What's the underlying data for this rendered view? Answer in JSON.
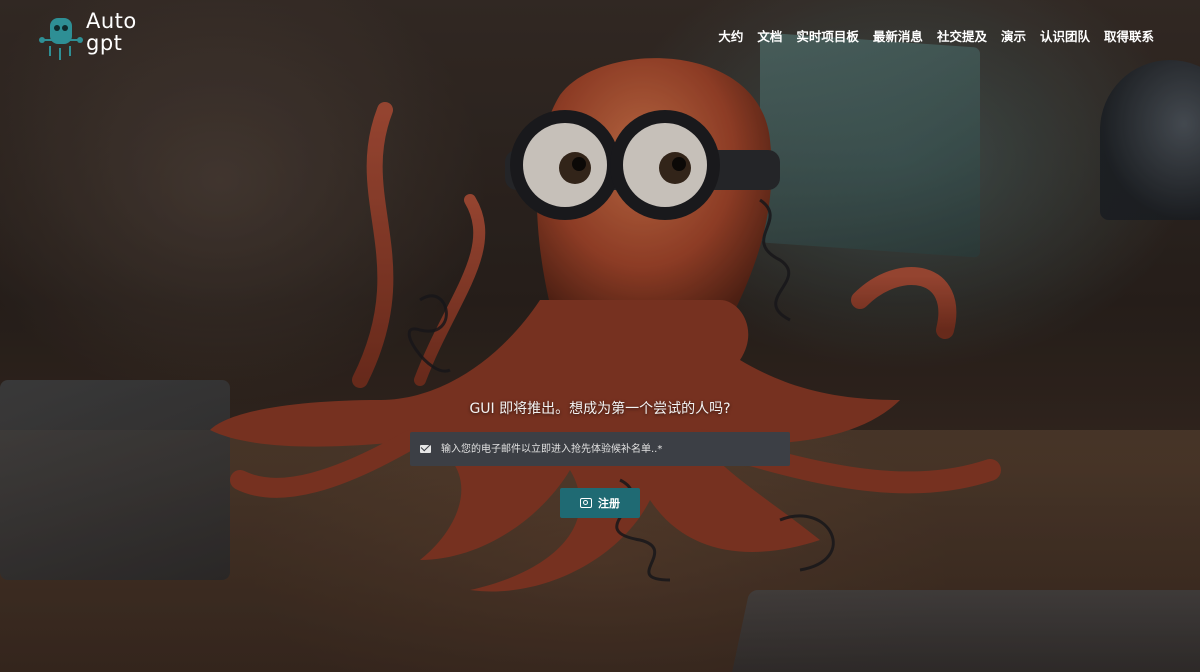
{
  "brand": {
    "logo_line1": "Auto",
    "logo_line2": "gpt",
    "accent": "#1f6a73"
  },
  "nav": {
    "items": [
      {
        "label": "大约"
      },
      {
        "label": "文档"
      },
      {
        "label": "实时项目板"
      },
      {
        "label": "最新消息"
      },
      {
        "label": "社交提及"
      },
      {
        "label": "演示"
      },
      {
        "label": "认识团队"
      },
      {
        "label": "取得联系"
      }
    ]
  },
  "signup": {
    "title": "GUI 即将推出。想成为第一个尝试的人吗?",
    "email_placeholder": "输入您的电子邮件以立即进入抢先体验候补名单..*",
    "email_icon": "envelope-icon",
    "button_label": "注册",
    "button_icon": "sign-in-icon"
  }
}
